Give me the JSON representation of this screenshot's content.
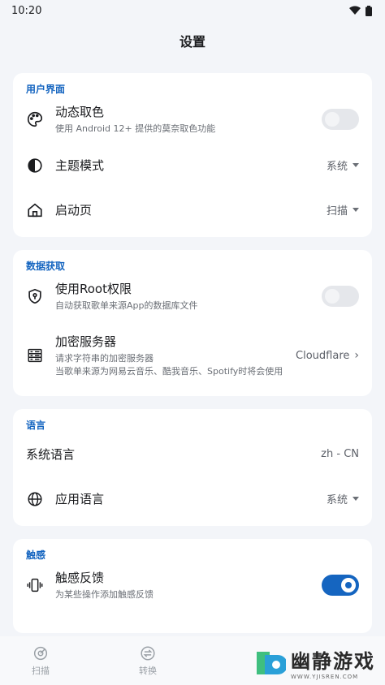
{
  "status_bar": {
    "time": "10:20"
  },
  "app": {
    "title": "设置"
  },
  "sections": {
    "ui": {
      "header": "用户界面",
      "dynamic_color": {
        "title": "动态取色",
        "subtitle": "使用 Android 12+ 提供的莫奈取色功能",
        "enabled": false
      },
      "theme_mode": {
        "title": "主题模式",
        "value": "系统"
      },
      "start_page": {
        "title": "启动页",
        "value": "扫描"
      }
    },
    "data": {
      "header": "数据获取",
      "root": {
        "title": "使用Root权限",
        "subtitle": "自动获取歌单来源App的数据库文件",
        "enabled": false
      },
      "encrypt_server": {
        "title": "加密服务器",
        "subtitle1": "请求字符串的加密服务器",
        "subtitle2": "当歌单来源为网易云音乐、酷我音乐、Spotify时将会使用",
        "value": "Cloudflare"
      }
    },
    "language": {
      "header": "语言",
      "system_language": {
        "title": "系统语言",
        "value": "zh - CN"
      },
      "app_language": {
        "title": "应用语言",
        "value": "系统"
      }
    },
    "haptics": {
      "header": "触感",
      "haptic_feedback": {
        "title": "触感反馈",
        "subtitle": "为某些操作添加触感反馈",
        "enabled": true
      }
    }
  },
  "bottom_nav": {
    "scan": "扫描",
    "convert": "转换"
  },
  "watermark": {
    "main": "幽静游戏",
    "sub": "WWW.YJISREN.COM"
  },
  "colors": {
    "accent": "#1565c0",
    "background": "#f3f5f9",
    "card": "#ffffff"
  }
}
